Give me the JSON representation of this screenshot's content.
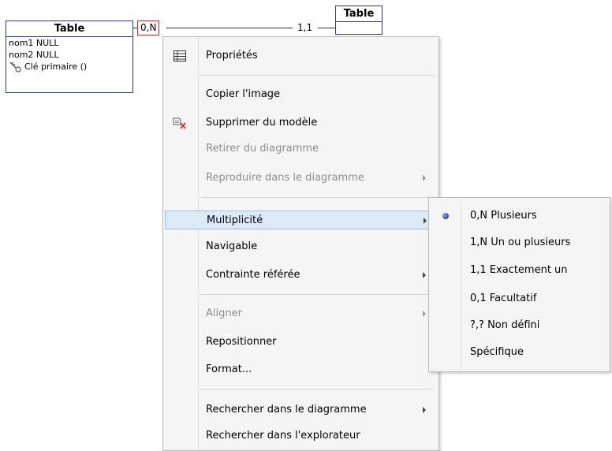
{
  "diagram": {
    "table1": {
      "title": "Table",
      "rows": [
        "nom1 NULL",
        "nom2 NULL"
      ],
      "key": "Clé primaire ()"
    },
    "table2": {
      "title": "Table"
    },
    "cardinality_left": "0,N",
    "cardinality_right": "1,1"
  },
  "menu": {
    "properties": "Propriétés",
    "copy_image": "Copier l'image",
    "delete_model": "Supprimer du modèle",
    "remove_diagram": "Retirer du diagramme",
    "reproduce_diagram": "Reproduire dans le diagramme",
    "multiplicity": "Multiplicité",
    "navigable": "Navigable",
    "constraint": "Contrainte référée",
    "align": "Aligner",
    "reposition": "Repositionner",
    "format": "Format...",
    "search_diagram": "Rechercher dans le diagramme",
    "search_explorer": "Rechercher dans l'explorateur"
  },
  "submenu": {
    "items": [
      "0,N Plusieurs",
      "1,N Un ou plusieurs",
      "1,1 Exactement un",
      "0,1 Facultatif",
      "?,? Non défini",
      "Spécifique"
    ],
    "selected": "0,N Plusieurs"
  }
}
